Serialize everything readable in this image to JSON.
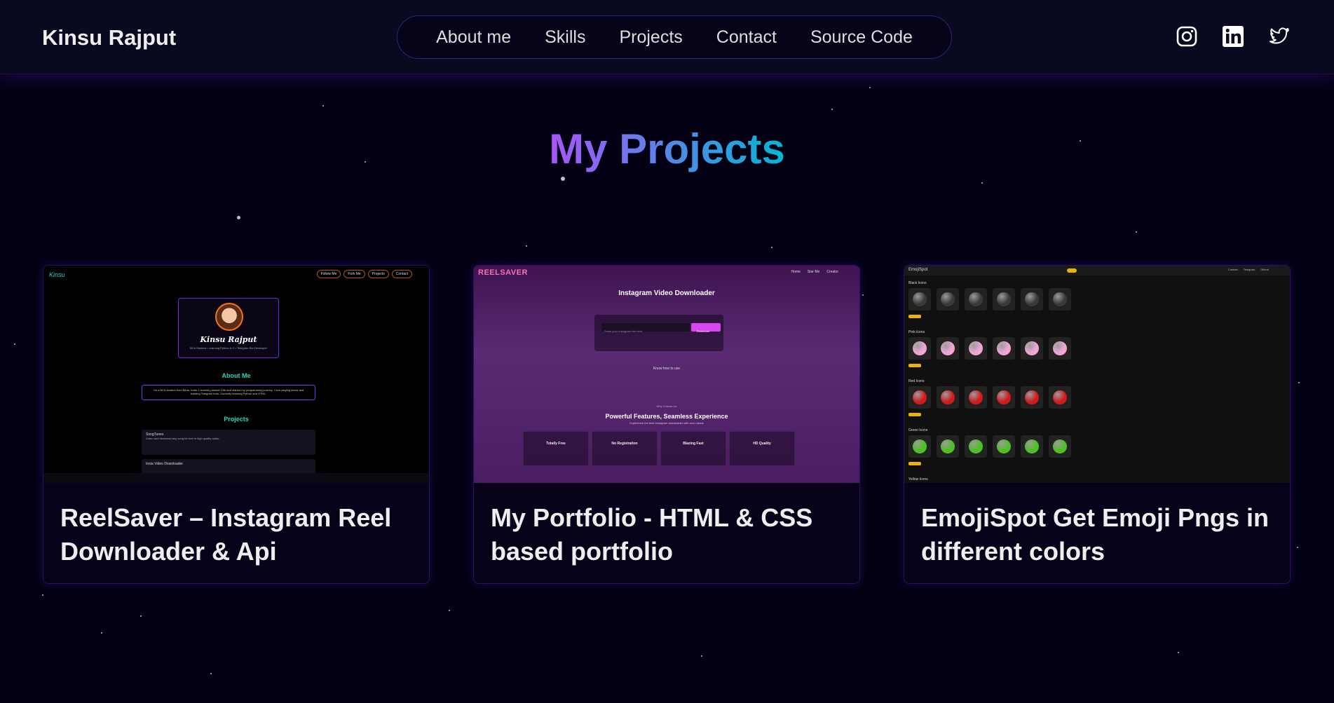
{
  "navbar": {
    "brand": "Kinsu Rajput",
    "links": [
      "About me",
      "Skills",
      "Projects",
      "Contact",
      "Source Code"
    ],
    "socials": [
      "instagram-icon",
      "linkedin-icon",
      "twitter-icon"
    ]
  },
  "section": {
    "title": "My Projects"
  },
  "projects": [
    {
      "title": "ReelSaver – Instagram Reel Downloader & Api",
      "thumb": {
        "logo": "Kinsu",
        "nav": [
          "Follow Me",
          "Fork Me",
          "Projects",
          "Contact"
        ],
        "name": "Kinsu Rajput",
        "subtitle": "BCA Student • Learning Python & C • Telegram Bot Developer",
        "about_heading": "About Me",
        "about_text": "I'm a BCA student from Bihar, India. I recently passed 12th and started my programming journey. I love playing chess and building Telegram bots. Currently learning Python and HTML.",
        "projects_heading": "Projects",
        "project_1": "SongTunes",
        "project_1_desc": "Listen and download any song for free in high quality audio.",
        "project_2": "Insta Video Downloader"
      }
    },
    {
      "title": "My Portfolio - HTML & CSS based portfolio",
      "thumb": {
        "logo": "REELSAVER",
        "nav": [
          "Home",
          "Star Me",
          "Creator"
        ],
        "heading": "Instagram Video Downloader",
        "input_placeholder": "Paste your Instagram link here",
        "button": "Download",
        "hint": "Know how to use",
        "why": "Why Choose Us",
        "features_heading": "Powerful Features, Seamless Experience",
        "features_sub": "Experience the best Instagram downloader with zero hassle",
        "features": [
          "Totally Free",
          "No Registration",
          "Blazing Fast",
          "HD Quality"
        ]
      }
    },
    {
      "title": "EmojiSpot Get Emoji Pngs in different colors",
      "thumb": {
        "logo": "EmojiSpot",
        "links": [
          "Contact",
          "Telegram",
          "Github"
        ],
        "groups": [
          {
            "label": "Black Icons",
            "color": "#3a3a3a"
          },
          {
            "label": "Pink Icons",
            "color": "#f0a6d8"
          },
          {
            "label": "Red Icons",
            "color": "#d41a1a"
          },
          {
            "label": "Green Icons",
            "color": "#4cc21e"
          }
        ],
        "more": "More",
        "next_group": "Yellow Icons"
      }
    }
  ]
}
